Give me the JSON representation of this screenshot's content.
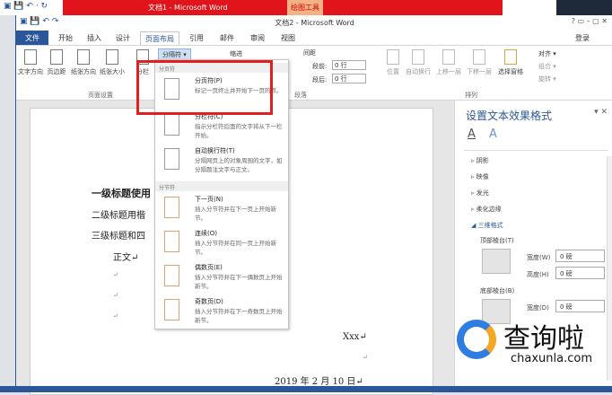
{
  "back_window": {
    "title": "文档1 - Microsoft Word",
    "context_tab": "绘图工具"
  },
  "window": {
    "title": "文档2 - Microsoft Word",
    "help": "?",
    "login": "登录"
  },
  "tabs": [
    "文件",
    "开始",
    "插入",
    "设计",
    "页面布局",
    "引用",
    "邮件",
    "审阅",
    "视图"
  ],
  "ribbon": {
    "page_setup": {
      "label": "页面设置",
      "buttons": [
        "文字方向",
        "页边距",
        "纸张方向",
        "纸张大小",
        "分栏"
      ]
    },
    "breaks_button": "分隔符 ▾",
    "indent_label": "缩进",
    "spacing_label": "间距",
    "paragraph": {
      "label": "段落",
      "before_label": "段前:",
      "before_value": "0 行",
      "after_label": "段后:",
      "after_value": "0 行"
    },
    "arrange": {
      "label": "排列",
      "buttons": [
        "位置",
        "自动换行",
        "上移一层",
        "下移一层",
        "选择窗格"
      ],
      "small": [
        "对齐 ▾",
        "组合 ▾",
        "旋转 ▾"
      ]
    }
  },
  "menu": {
    "section1": "分页符",
    "items1": [
      {
        "label": "分页符(P)",
        "desc": "标记一页终止并开始下一页的点。"
      },
      {
        "label": "分栏符(C)",
        "desc": "指示分栏符后面的文字将从下一栏开始。"
      },
      {
        "label": "自动换行符(T)",
        "desc": "分隔网页上的对象周围的文字，如分隔题注文字与正文。"
      }
    ],
    "section2": "分节符",
    "items2": [
      {
        "label": "下一页(N)",
        "desc": "插入分节符并在下一页上开始新节。"
      },
      {
        "label": "连续(O)",
        "desc": "插入分节符并在同一页上开始新节。"
      },
      {
        "label": "偶数页(E)",
        "desc": "插入分节符并在下一偶数页上开始新节。"
      },
      {
        "label": "奇数页(D)",
        "desc": "插入分节符并在下一奇数页上开始新节。"
      }
    ]
  },
  "document": {
    "lines": [
      "一级标题使用",
      "二级标题用楷",
      "三级标题和四",
      "正文↵",
      "↵",
      "↵",
      "↵"
    ],
    "signature": "Xxx↵",
    "blank": "↵",
    "date": "2019 年 2 月 10 日↵"
  },
  "pane": {
    "title": "设置文本效果格式",
    "sections": [
      "阴影",
      "映像",
      "发光",
      "柔化边缘",
      "三维格式"
    ],
    "top_bevel": "顶部棱台(T)",
    "bottom_bevel": "底部棱台(B)",
    "width_label": "宽度(W)",
    "height_label": "高度(H)",
    "width2_label": "宽度(D)",
    "value": "0 磅"
  },
  "watermark": {
    "name": "查询啦",
    "url": "chaxunla.com"
  }
}
